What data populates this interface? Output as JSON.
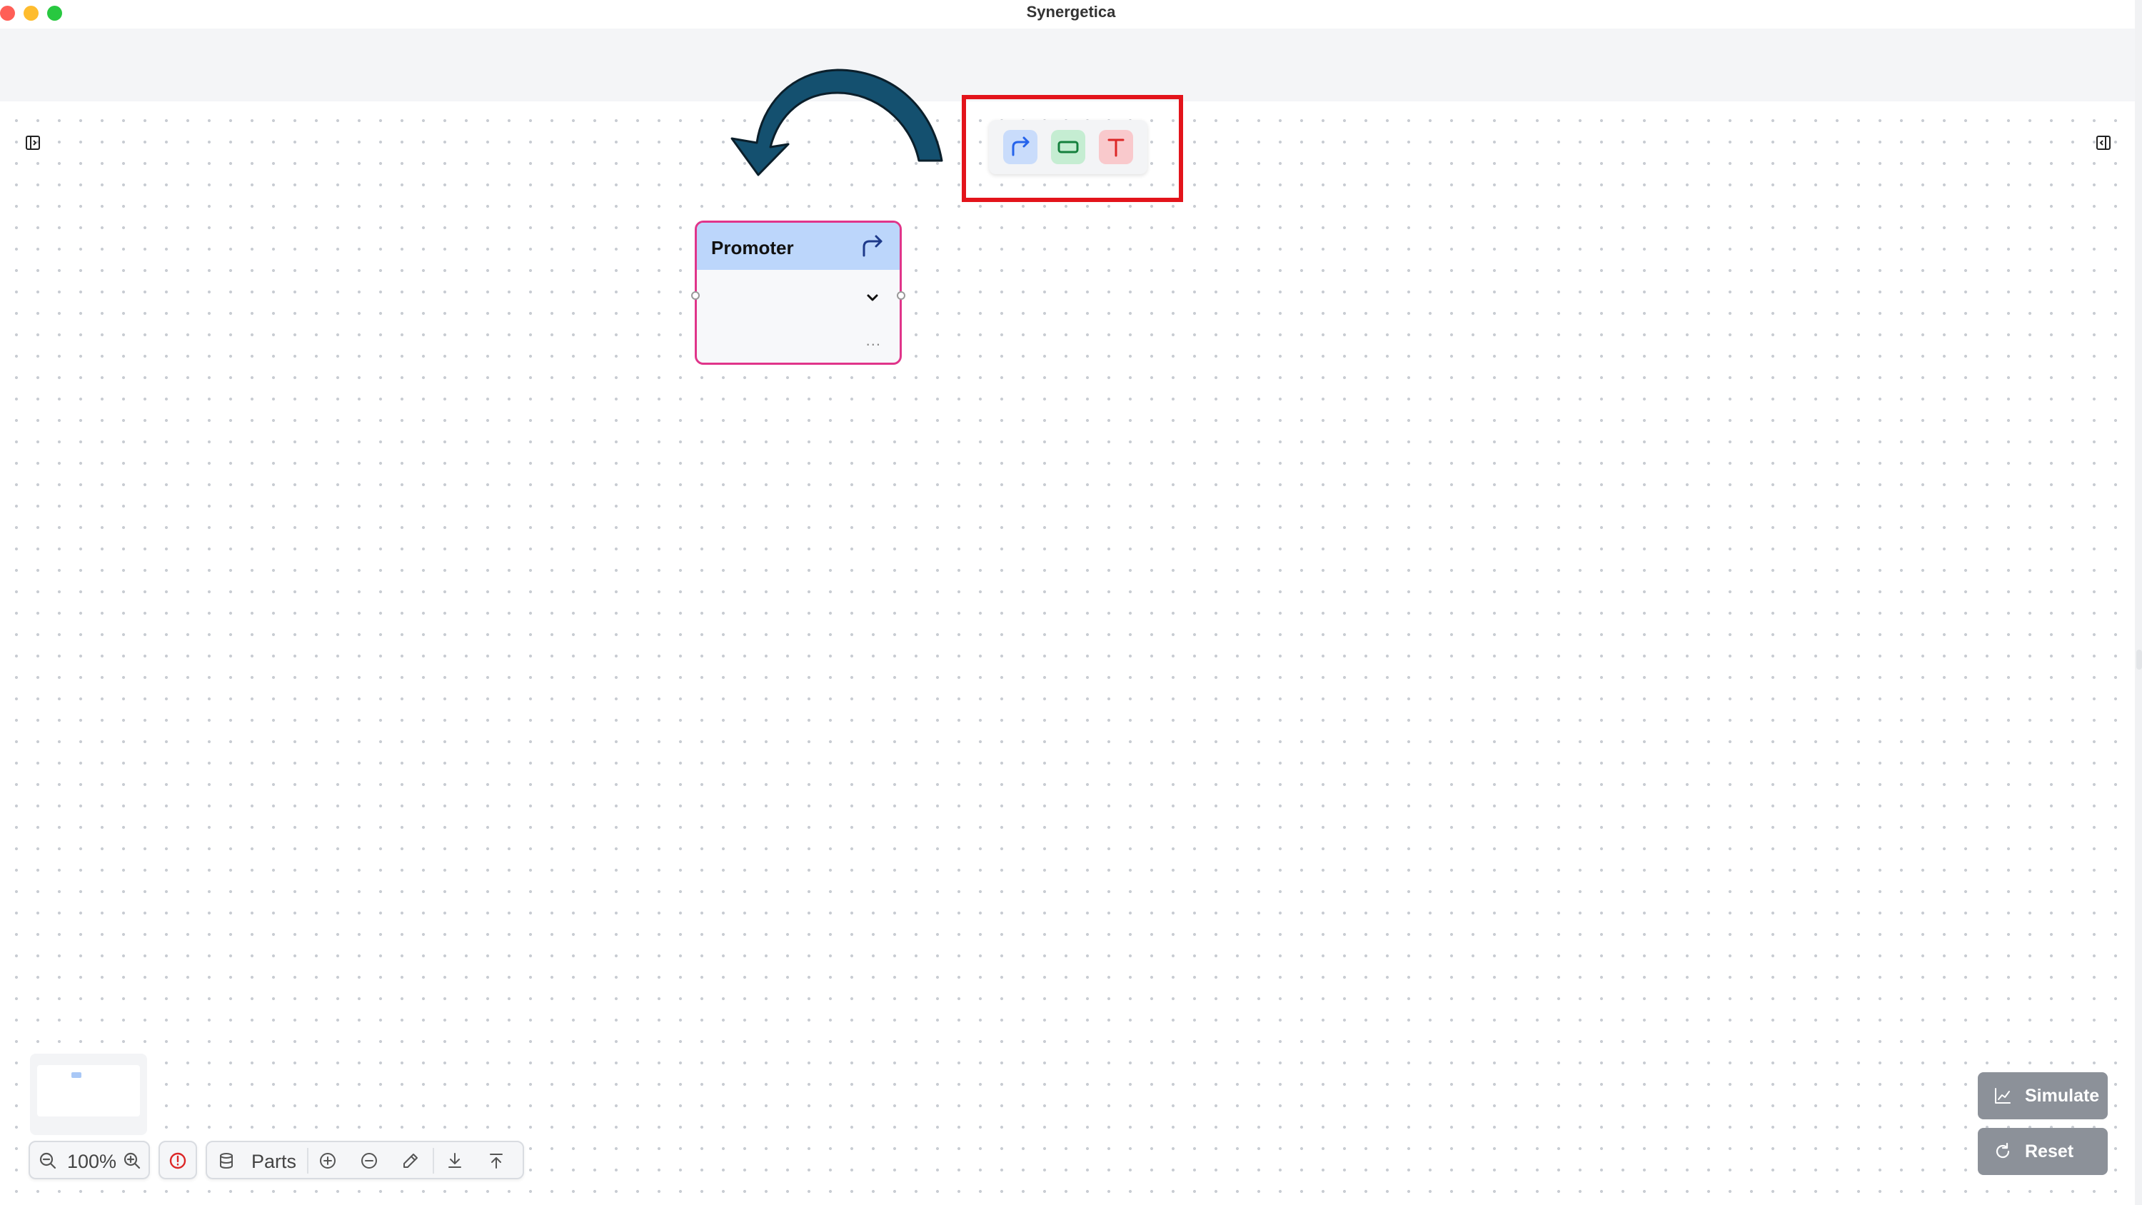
{
  "window": {
    "title": "Synergetica"
  },
  "canvas": {
    "node": {
      "title": "Promoter",
      "more": "..."
    }
  },
  "palette": {
    "items": [
      {
        "name": "promoter",
        "icon": "promoter-arrow-icon",
        "color": "#2563eb"
      },
      {
        "name": "rectangle",
        "icon": "rectangle-icon",
        "color": "#16a34a"
      },
      {
        "name": "text",
        "icon": "text-icon",
        "label": "T",
        "color": "#dc2626"
      }
    ]
  },
  "annotation": {
    "arrow_color": "#14506f",
    "highlight_color": "#e3141b"
  },
  "controls": {
    "zoom_level": "100%",
    "parts_label": "Parts"
  },
  "actions": {
    "simulate_label": "Simulate",
    "reset_label": "Reset"
  }
}
